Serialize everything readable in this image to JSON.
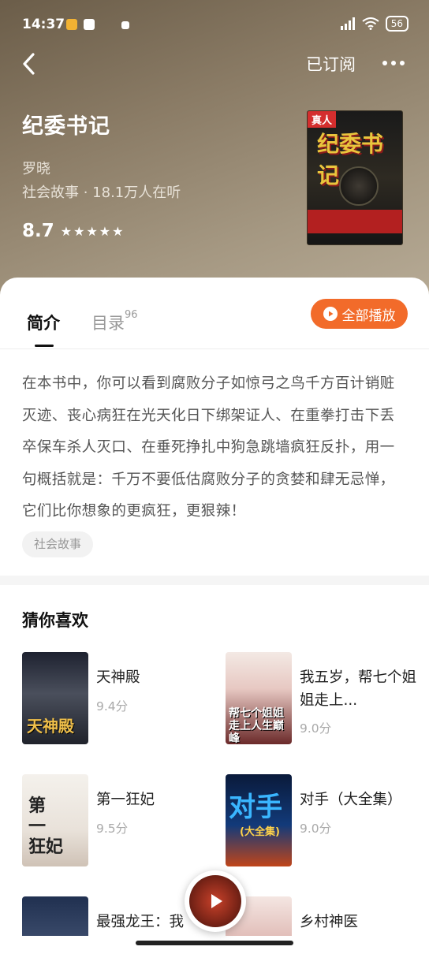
{
  "status": {
    "time": "14:37",
    "battery": "56"
  },
  "header": {
    "subscribe": "已订阅"
  },
  "book": {
    "title": "纪委书记",
    "author": "罗晓",
    "meta": "社会故事 · 18.1万人在听",
    "rating": "8.7",
    "stars": "★★★★★",
    "cover_tag": "真人",
    "cover_title": "纪委书记"
  },
  "tabs": {
    "intro": "简介",
    "toc": "目录",
    "toc_count": "96"
  },
  "play_all": "全部播放",
  "description": "在本书中，你可以看到腐败分子如惊弓之鸟千方百计销赃灭迹、丧心病狂在光天化日下绑架证人、在重拳打击下丢卒保车杀人灭口、在垂死挣扎中狗急跳墙疯狂反扑，用一句概括就是：千万不要低估腐败分子的贪婪和肆无忌惮，它们比你想象的更疯狂，更狠辣！",
  "tag": "社会故事",
  "recommend": {
    "title": "猜你喜欢",
    "items": [
      {
        "name": "天神殿",
        "score": "9.4分"
      },
      {
        "name": "我五岁，帮七个姐姐走上...",
        "score": "9.0分"
      },
      {
        "name": "第一狂妃",
        "score": "9.5分"
      },
      {
        "name": "对手（大全集）",
        "score": "9.0分"
      },
      {
        "name": "最强龙王：我",
        "score": ""
      },
      {
        "name": "乡村神医",
        "score": ""
      }
    ]
  },
  "colors": {
    "accent": "#f26b2a",
    "hero_bg": "#8a7b65"
  }
}
